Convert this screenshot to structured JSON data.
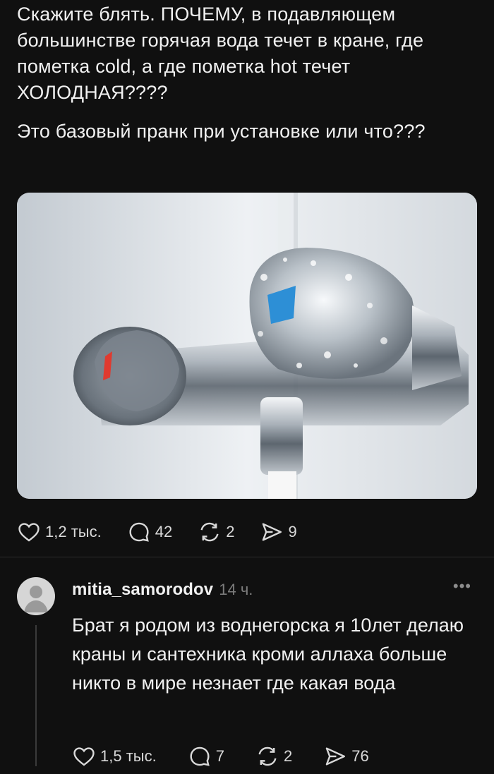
{
  "post": {
    "paragraphs": [
      "Скажите блять. ПОЧЕМУ, в подавляющем большинстве горячая вода течет в кране, где пометка cold, а где пометка hot течет ХОЛОДНАЯ????",
      "Это базовый пранк при установке или что???"
    ],
    "image_icon": "faucet-photo",
    "likes": "1,2 тыс.",
    "comments": "42",
    "reposts": "2",
    "shares": "9"
  },
  "comment": {
    "username": "mitia_samorodov",
    "time": "14 ч.",
    "more_icon": "•••",
    "text": "Брат я родом из воднегорска я 10лет делаю краны и сантехника кроми аллаха больше никто в мире незнает где какая вода",
    "likes": "1,5 тыс.",
    "comments": "7",
    "reposts": "2",
    "shares": "76"
  },
  "colors": {
    "background": "#101010",
    "text": "#f1f1f1",
    "muted": "#7c7c7c",
    "hot_marker": "#e03a2f",
    "cold_marker": "#2d8fd6"
  }
}
